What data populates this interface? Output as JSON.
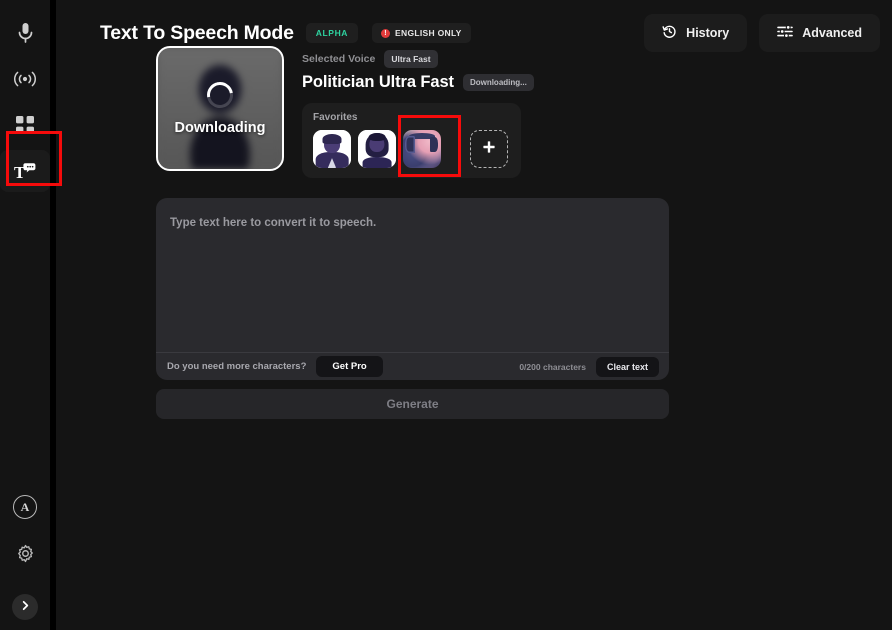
{
  "sidebar": {
    "top_items": [
      {
        "name": "voice-changer",
        "icon": "microphone-icon",
        "active": false
      },
      {
        "name": "soundboard",
        "icon": "broadcast-icon",
        "active": false
      },
      {
        "name": "voice-library",
        "icon": "grid-icon",
        "active": false
      },
      {
        "name": "text-to-speech",
        "icon": "text-speech-icon",
        "active": true
      }
    ],
    "bottom_items": [
      {
        "name": "account",
        "icon": "avatar-icon",
        "label": "A"
      },
      {
        "name": "settings",
        "icon": "gear-icon",
        "label": ""
      }
    ],
    "expand": {
      "icon": "chevron-right-icon",
      "label": ""
    }
  },
  "header": {
    "title": "Text To Speech Mode",
    "alpha_badge": "ALPHA",
    "english_badge": "ENGLISH ONLY",
    "english_badge_icon": "warning-dot-icon",
    "history_label": "History",
    "history_icon": "history-clock-icon",
    "advanced_label": "Advanced",
    "advanced_icon": "sliders-icon"
  },
  "voice": {
    "card_status": "Downloading",
    "card_icon": "loading-spinner-icon",
    "selected_label": "Selected Voice",
    "speed_chip": "Ultra Fast",
    "name": "Politician Ultra Fast",
    "download_chip": "Downloading..."
  },
  "favorites": {
    "title": "Favorites",
    "items": [
      {
        "name": "favorite-avatar-1",
        "alt": "purple-male-silhouette-avatar"
      },
      {
        "name": "favorite-avatar-2",
        "alt": "purple-female-silhouette-avatar"
      },
      {
        "name": "favorite-avatar-3",
        "alt": "anime-character-headphones-avatar"
      }
    ],
    "add_label": "+",
    "add_icon": "plus-icon"
  },
  "editor": {
    "placeholder": "Type text here to convert it to speech.",
    "value": "",
    "more_characters_hint": "Do you need more characters?",
    "get_pro_label": "Get Pro",
    "character_count": "0/200 characters",
    "clear_label": "Clear text",
    "generate_label": "Generate"
  },
  "colors": {
    "background": "#141414",
    "panel": "#1e1e1e",
    "editor": "#2a2a2e",
    "accent_green": "#2ed3a0",
    "accent_red": "#e23b3b",
    "highlight": "#f60b0b"
  }
}
